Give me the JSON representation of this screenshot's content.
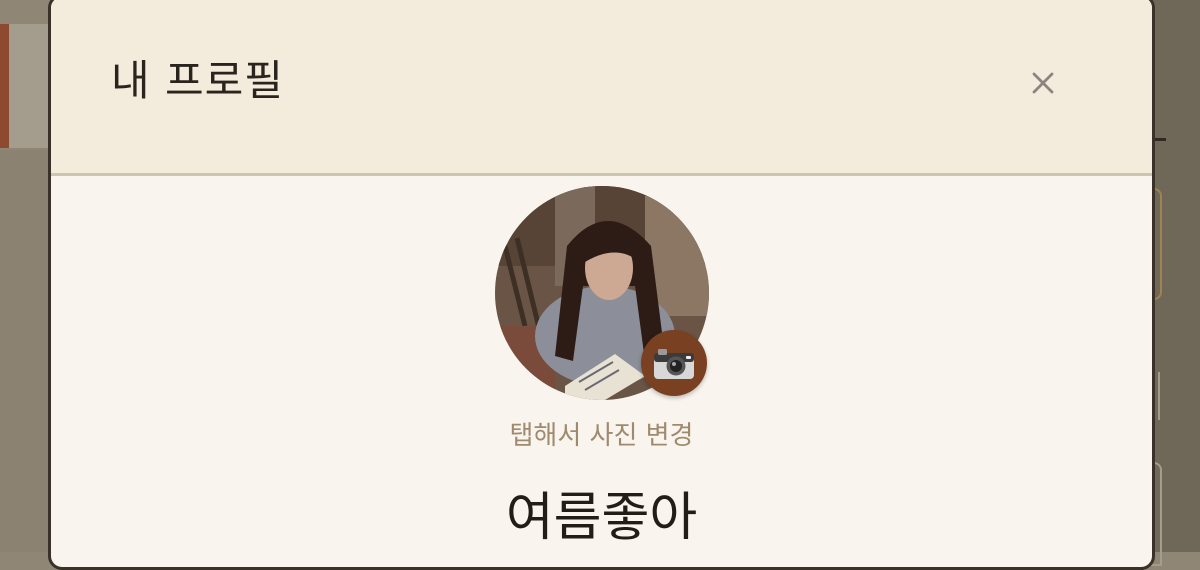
{
  "modal": {
    "title": "내 프로필",
    "close_icon": "close-icon"
  },
  "profile": {
    "avatar_icon": "profile-photo",
    "camera_icon": "camera-icon",
    "photo_hint": "탭해서 사진 변경",
    "nickname": "여름좋아"
  },
  "colors": {
    "header_bg": "#f3ecdc",
    "body_bg": "#f9f5ee",
    "camera_button": "#7a4022",
    "hint_text": "#a08a6e",
    "accent": "#8e4a2f"
  }
}
